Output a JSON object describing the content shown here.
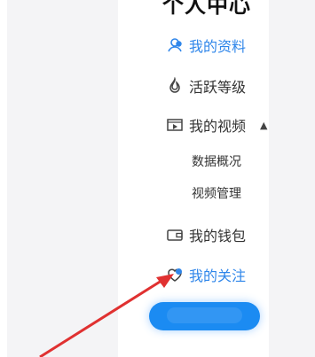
{
  "sidebar": {
    "title": "个人中心",
    "items": [
      {
        "label": "我的资料",
        "icon": "user-icon",
        "active": true
      },
      {
        "label": "活跃等级",
        "icon": "fire-icon",
        "active": false
      },
      {
        "label": "我的视频",
        "icon": "video-icon",
        "active": false,
        "expanded": true,
        "children": [
          {
            "label": "数据概况"
          },
          {
            "label": "视频管理"
          }
        ]
      },
      {
        "label": "我的钱包",
        "icon": "wallet-icon",
        "active": false
      },
      {
        "label": "我的关注",
        "icon": "heart-icon",
        "active": true
      }
    ]
  },
  "colors": {
    "accent": "#2f86ea",
    "button": "#1b8bf2",
    "arrow": "#e03131"
  }
}
